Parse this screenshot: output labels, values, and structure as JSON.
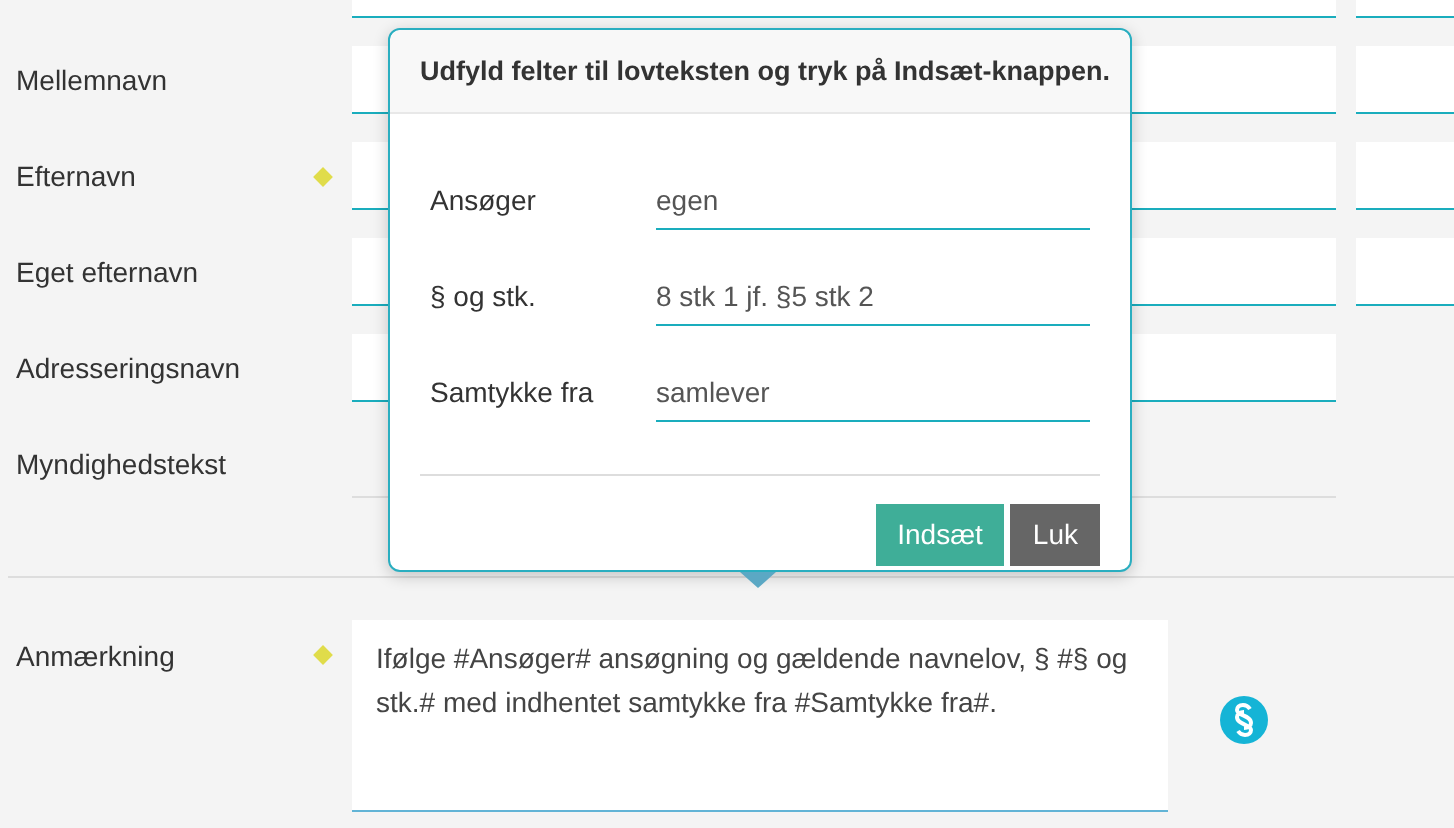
{
  "form_rows": [
    {
      "label": null,
      "required": false,
      "kind": "input",
      "side_field": true
    },
    {
      "label": "Mellemnavn",
      "required": false,
      "kind": "input",
      "side_field": true
    },
    {
      "label": "Efternavn",
      "required": true,
      "kind": "input",
      "side_field": true
    },
    {
      "label": "Eget efternavn",
      "required": false,
      "kind": "input",
      "side_field": true
    },
    {
      "label": "Adresseringsnavn",
      "required": false,
      "kind": "input",
      "side_field": false
    },
    {
      "label": "Myndighedstekst",
      "required": false,
      "kind": "static",
      "side_field": false
    }
  ],
  "remark": {
    "label": "Anmærkning",
    "required": true,
    "value": "Ifølge #Ansøger# ansøgning og gældende navnelov, § #§ og stk.# med indhentet samtykke fra #Samtykke fra#."
  },
  "popup": {
    "title": "Udfyld felter til lovteksten og tryk på Indsæt-knappen.",
    "fields": [
      {
        "label": "Ansøger",
        "value": "egen"
      },
      {
        "label": "§ og stk.",
        "value": "8 stk 1 jf. §5 stk 2"
      },
      {
        "label": "Samtykke fra",
        "value": "samlever"
      }
    ],
    "buttons": [
      {
        "label": "Indsæt",
        "kind": "primary"
      },
      {
        "label": "Luk",
        "kind": "secondary"
      }
    ]
  }
}
